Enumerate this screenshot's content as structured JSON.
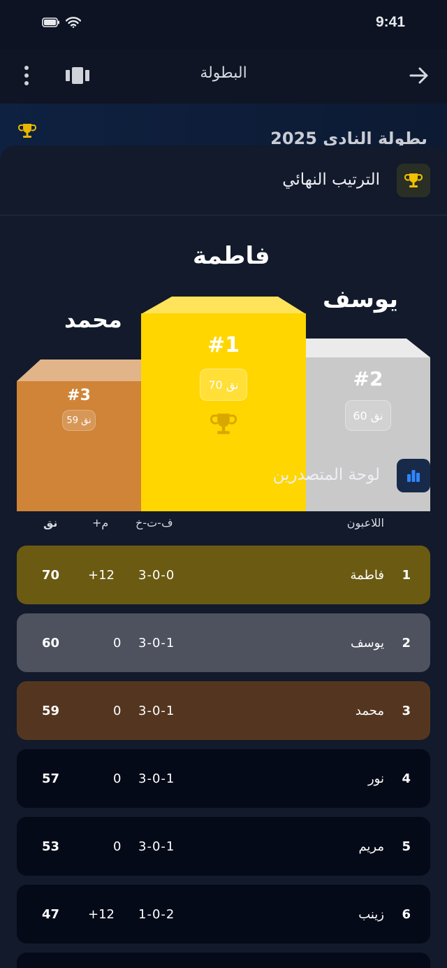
{
  "status": {
    "time": "9:41"
  },
  "topbar": {
    "title": "البطولة"
  },
  "banner": {
    "title": "بطولة النادي 2025"
  },
  "final": {
    "title": "الترتيب النهائي"
  },
  "podium": {
    "first": {
      "name": "فاطمة",
      "rank": "#1",
      "points": "70 نق"
    },
    "second": {
      "name": "يوسف",
      "rank": "#2",
      "points": "60 نق"
    },
    "third": {
      "name": "محمد",
      "rank": "#3",
      "points": "59 نق"
    }
  },
  "leaderboard": {
    "title": "لوحة المتصدرين",
    "columns": {
      "players": "اللاعبون",
      "record": "ف-ت-خ",
      "diff": "+م",
      "points": "نق"
    },
    "rows": [
      {
        "rank": "1",
        "name": "فاطمة",
        "record": "3-0-0",
        "diff": "+12",
        "points": "70"
      },
      {
        "rank": "2",
        "name": "يوسف",
        "record": "3-0-1",
        "diff": "0",
        "points": "60"
      },
      {
        "rank": "3",
        "name": "محمد",
        "record": "3-0-1",
        "diff": "0",
        "points": "59"
      },
      {
        "rank": "4",
        "name": "نور",
        "record": "3-0-1",
        "diff": "0",
        "points": "57"
      },
      {
        "rank": "5",
        "name": "مريم",
        "record": "3-0-1",
        "diff": "0",
        "points": "53"
      },
      {
        "rank": "6",
        "name": "زينب",
        "record": "1-0-2",
        "diff": "+12",
        "points": "47"
      }
    ]
  },
  "colors": {
    "gold": "#ffd600",
    "silver": "#c9c9c9",
    "bronze": "#d08437",
    "row1": "#6b5a12",
    "row2": "#4d525e",
    "row3": "#543620",
    "rowDefault": "#050a18"
  }
}
